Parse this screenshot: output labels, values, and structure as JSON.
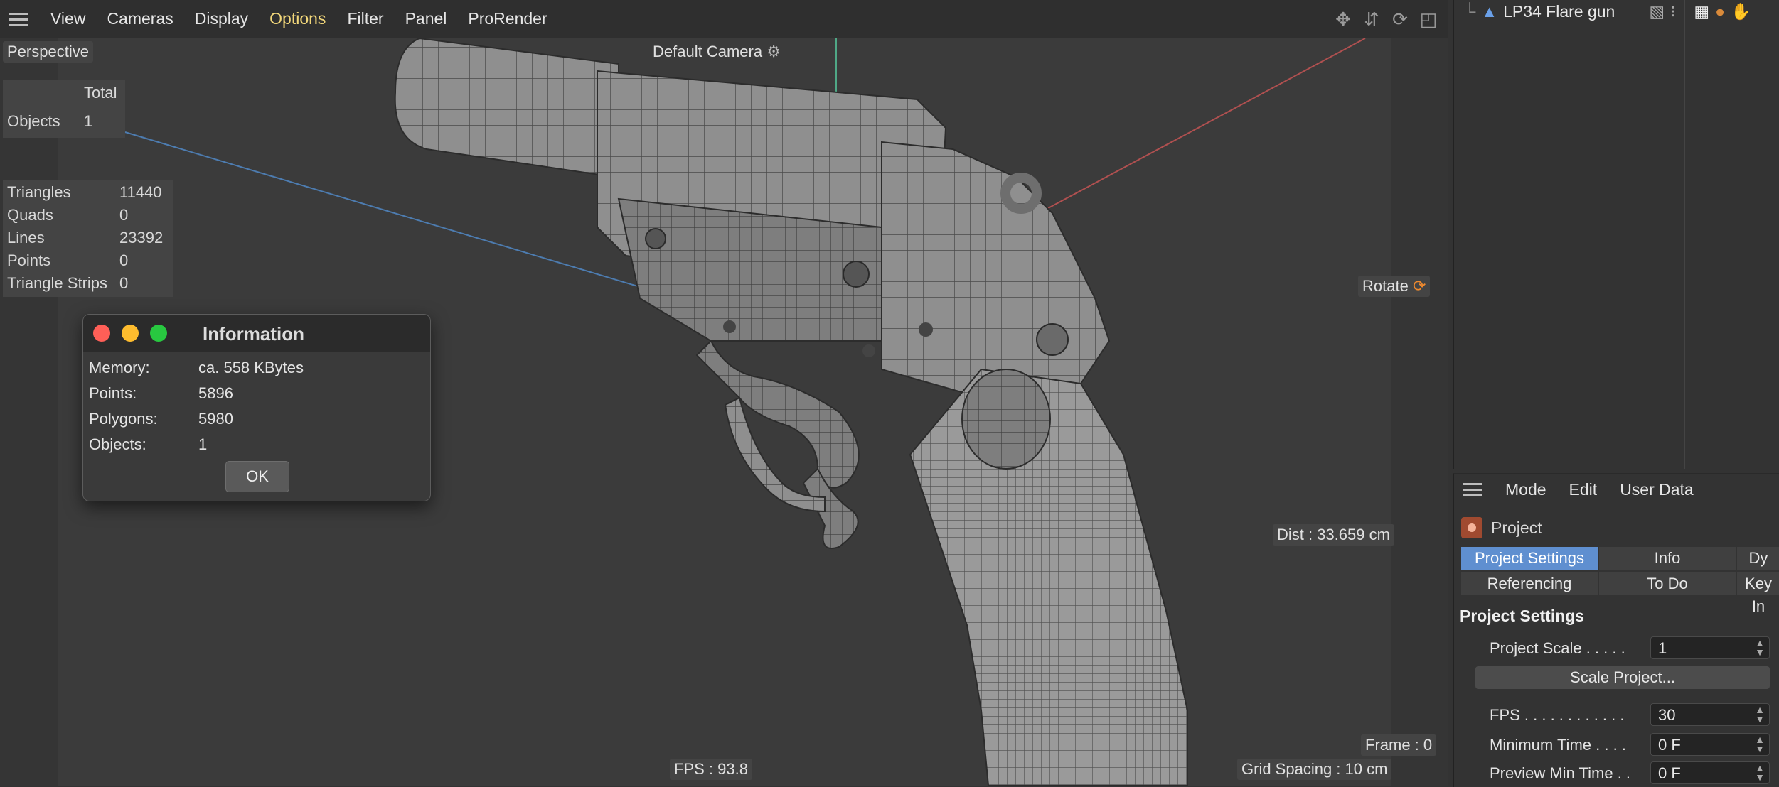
{
  "viewport": {
    "menu": [
      "View",
      "Cameras",
      "Display",
      "Options",
      "Filter",
      "Panel",
      "ProRender"
    ],
    "active_menu": "Options",
    "view_mode": "Perspective",
    "camera": "Default Camera",
    "stats_header": "Total",
    "objects_label": "Objects",
    "objects_value": "1",
    "geometry_stats": [
      {
        "label": "Triangles",
        "value": "11440"
      },
      {
        "label": "Quads",
        "value": "0"
      },
      {
        "label": "Lines",
        "value": "23392"
      },
      {
        "label": "Points",
        "value": "0"
      },
      {
        "label": "Triangle Strips",
        "value": "0"
      }
    ],
    "rotate": "Rotate",
    "dist": "Dist : 33.659 cm",
    "frame": "Frame : 0",
    "fps": "FPS : 93.8",
    "grid": "Grid Spacing : 10 cm"
  },
  "info_dialog": {
    "title": "Information",
    "rows": [
      {
        "key": "Memory:",
        "value": "ca. 558 KBytes"
      },
      {
        "key": "Points:",
        "value": "5896"
      },
      {
        "key": "Polygons:",
        "value": "5980"
      },
      {
        "key": "Objects:",
        "value": "1"
      }
    ],
    "ok": "OK"
  },
  "object_manager": {
    "item": "LP34 Flare gun"
  },
  "attribute_manager": {
    "menu": [
      "Mode",
      "Edit",
      "User Data"
    ],
    "object": "Project",
    "tabs_row1": [
      "Project Settings",
      "Info",
      "Dy"
    ],
    "tabs_row2": [
      "Referencing",
      "To Do",
      "Key In"
    ],
    "active_tab": "Project Settings",
    "section": "Project Settings",
    "project_scale_label": "Project Scale . . . . .",
    "project_scale_value": "1",
    "scale_button": "Scale Project...",
    "fps_label": "FPS . . . . . . . . . . . .",
    "fps_value": "30",
    "min_time_label": "Minimum Time . . . .",
    "min_time_value": "0 F",
    "preview_min_label": "Preview Min Time . .",
    "preview_min_value": "0 F"
  }
}
